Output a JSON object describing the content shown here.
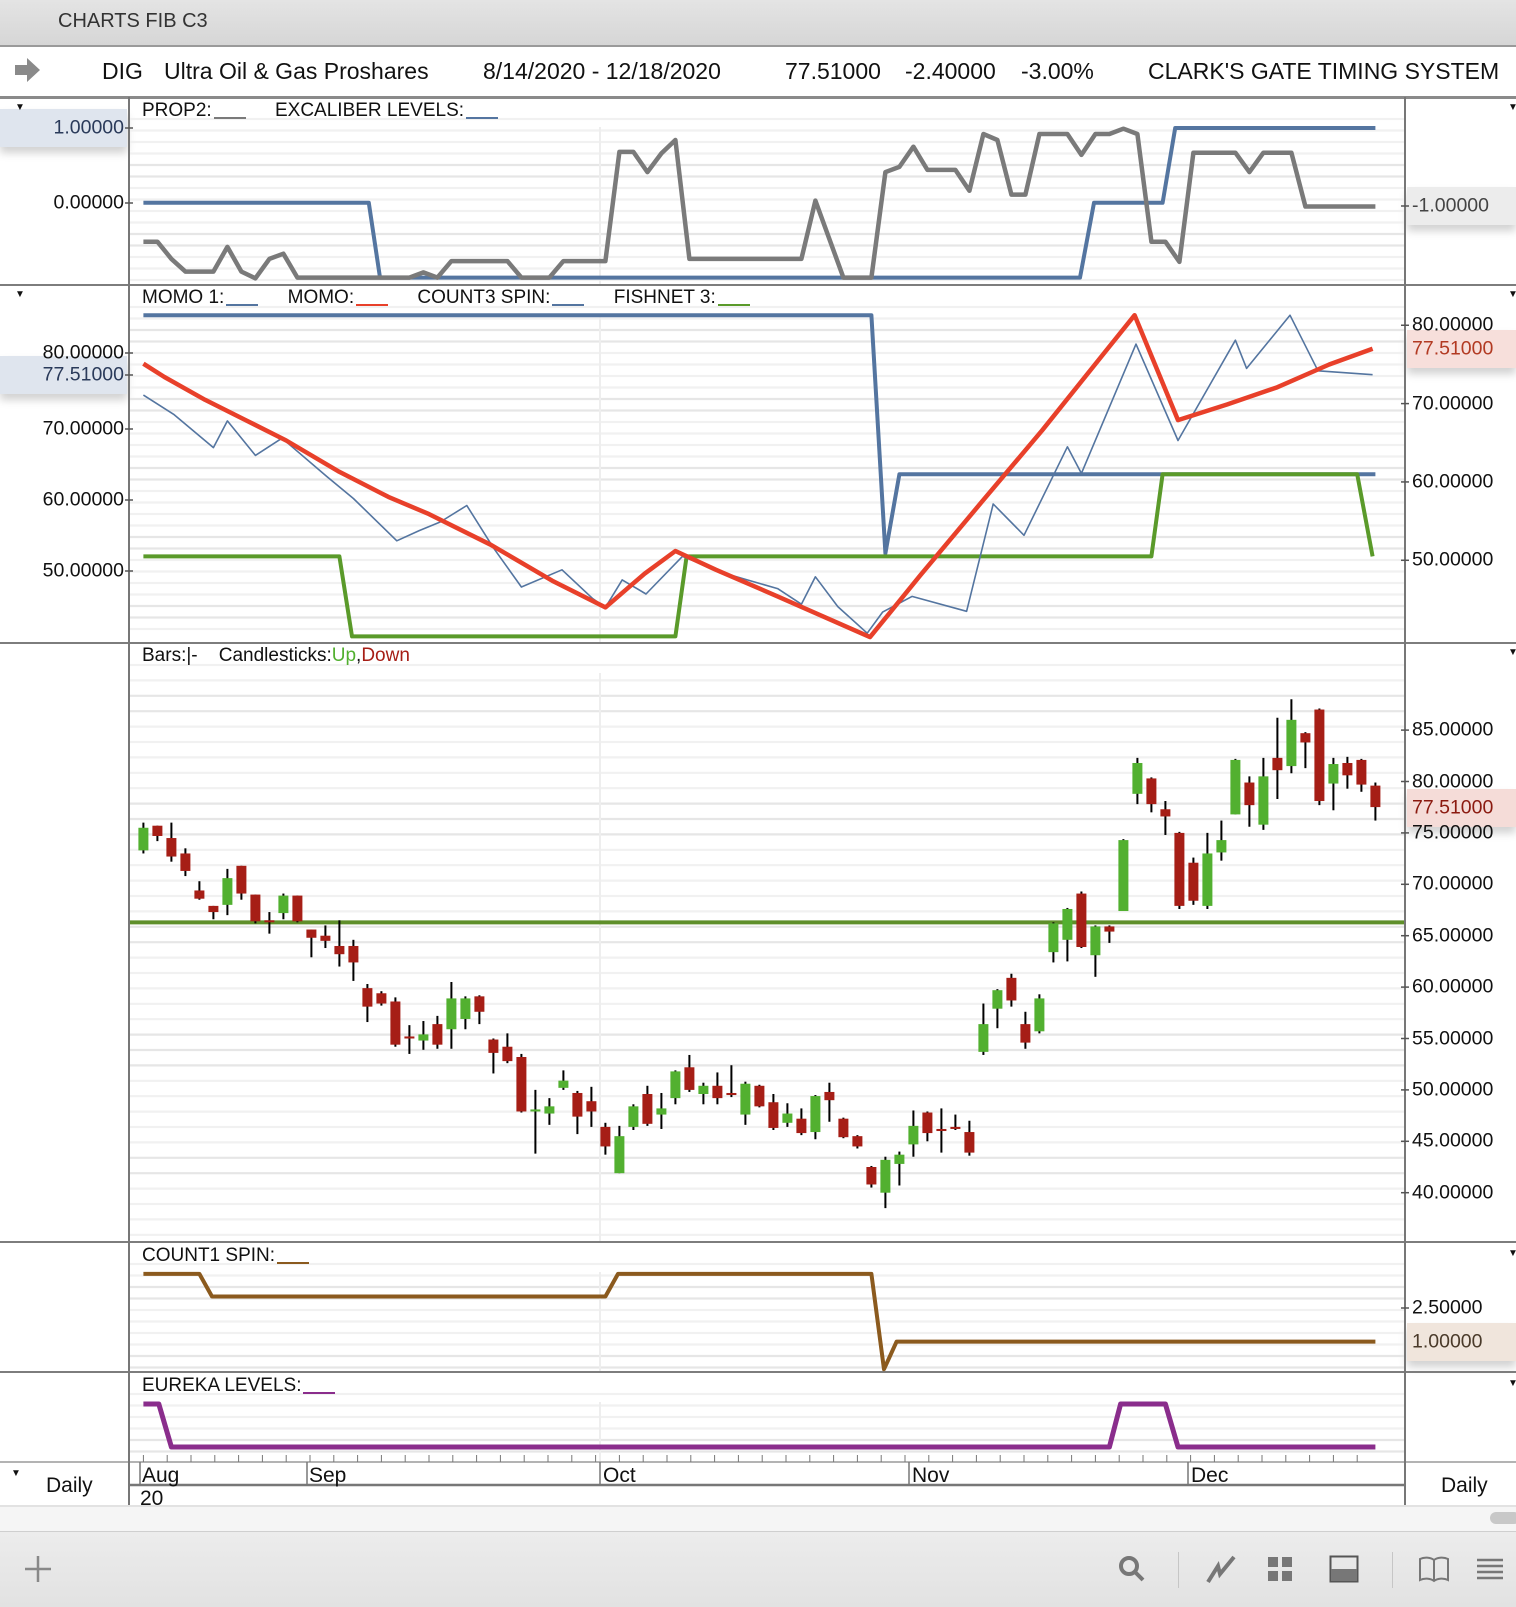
{
  "window": {
    "title": "CHARTS FIB C3"
  },
  "header": {
    "symbol": "DIG",
    "name": "Ultra Oil & Gas Proshares",
    "date_range": "8/14/2020 - 12/18/2020",
    "last": "77.51000",
    "change": "-2.40000",
    "change_pct": "-3.00%",
    "system": "CLARK'S GATE TIMING SYSTEM"
  },
  "panels": {
    "p1": {
      "legend": [
        {
          "label": "PROP2:",
          "color": "#7a7a7a"
        },
        {
          "label": "EXCALIBER LEVELS:",
          "color": "#5475a0"
        }
      ],
      "left_labels": [
        "1.00000",
        "0.00000"
      ],
      "right_label": "-1.00000"
    },
    "p2": {
      "legend": [
        {
          "label": "MOMO 1:",
          "color": "#5475a0"
        },
        {
          "label": "MOMO:",
          "color": "#e8402a"
        },
        {
          "label": "COUNT3 SPIN:",
          "color": "#5475a0"
        },
        {
          "label": "FISHNET 3:",
          "color": "#5a9a2a"
        }
      ],
      "left_labels": [
        "80.00000",
        "77.51000",
        "70.00000",
        "60.00000",
        "50.00000"
      ],
      "right_labels": [
        "80.00000",
        "70.00000",
        "60.00000",
        "50.00000"
      ],
      "right_current": "77.51000"
    },
    "p3": {
      "bars_label": "Bars:",
      "bars_symbol": "|-",
      "candles_label": "Candlesticks:",
      "up": "Up",
      "comma": ",",
      "down": "Down",
      "up_color": "#52b030",
      "down_color": "#a61e16",
      "right_labels": [
        "85.00000",
        "80.00000",
        "75.00000",
        "70.00000",
        "65.00000",
        "60.00000",
        "55.00000",
        "50.00000",
        "45.00000",
        "40.00000"
      ],
      "right_current": "77.51000"
    },
    "p4": {
      "legend": [
        {
          "label": "COUNT1 SPIN:",
          "color": "#8b5a1e"
        }
      ],
      "right_labels": [
        "2.50000"
      ],
      "right_current": "1.00000"
    },
    "p5": {
      "legend": [
        {
          "label": "EUREKA LEVELS:",
          "color": "#8a2d8c"
        }
      ]
    }
  },
  "date_axis": {
    "months": [
      "Aug",
      "Sep",
      "Oct",
      "Nov",
      "Dec"
    ],
    "year": "20",
    "period_left": "Daily",
    "period_right": "Daily"
  },
  "toolbar": {
    "icons": [
      "add-icon",
      "search-icon",
      "line-chart-icon",
      "grid-icon",
      "panel-layout-icon",
      "book-icon",
      "menu-icon"
    ]
  },
  "chart_data": {
    "type": "candlestick",
    "title": "DIG Ultra Oil & Gas Proshares",
    "x_range": [
      "8/14/2020",
      "12/18/2020"
    ],
    "candles_ohlc": [
      [
        73.3,
        76.0,
        73.0,
        75.5
      ],
      [
        75.7,
        75.7,
        74.2,
        74.7
      ],
      [
        74.5,
        76.0,
        72.2,
        72.7
      ],
      [
        73.0,
        73.5,
        70.8,
        71.3
      ],
      [
        69.4,
        70.3,
        68.5,
        68.6
      ],
      [
        67.9,
        67.9,
        66.6,
        67.3
      ],
      [
        68.0,
        71.5,
        67.0,
        70.6
      ],
      [
        71.8,
        71.8,
        68.5,
        69.1
      ],
      [
        69.0,
        69.0,
        66.2,
        66.4
      ],
      [
        66.5,
        67.3,
        65.2,
        66.4
      ],
      [
        67.2,
        69.1,
        66.6,
        68.9
      ],
      [
        68.9,
        68.9,
        66.3,
        66.4
      ],
      [
        65.6,
        65.6,
        62.9,
        64.8
      ],
      [
        65.0,
        66.0,
        63.8,
        64.5
      ],
      [
        64.0,
        66.5,
        62.0,
        63.2
      ],
      [
        64.0,
        64.6,
        60.6,
        62.4
      ],
      [
        59.9,
        60.3,
        56.6,
        58.1
      ],
      [
        59.4,
        59.6,
        58.2,
        58.4
      ],
      [
        58.6,
        59.0,
        54.2,
        54.4
      ],
      [
        55.2,
        56.3,
        53.5,
        55.0
      ],
      [
        54.8,
        56.7,
        53.9,
        55.4
      ],
      [
        56.4,
        57.2,
        54.0,
        54.4
      ],
      [
        55.9,
        60.5,
        54.0,
        58.9
      ],
      [
        56.9,
        59.1,
        55.9,
        58.9
      ],
      [
        59.1,
        59.2,
        56.4,
        57.6
      ],
      [
        54.9,
        55.0,
        51.6,
        53.6
      ],
      [
        54.2,
        55.5,
        52.6,
        52.8
      ],
      [
        53.2,
        53.5,
        47.8,
        47.9
      ],
      [
        47.9,
        50.0,
        43.8,
        48.1
      ],
      [
        47.7,
        49.2,
        46.6,
        48.4
      ],
      [
        50.2,
        51.9,
        50.0,
        50.9
      ],
      [
        49.7,
        49.9,
        45.7,
        47.4
      ],
      [
        48.9,
        50.3,
        46.4,
        47.9
      ],
      [
        46.4,
        46.8,
        43.7,
        44.5
      ],
      [
        41.9,
        46.5,
        41.9,
        45.5
      ],
      [
        46.4,
        48.6,
        46.1,
        48.4
      ],
      [
        49.6,
        50.4,
        46.5,
        46.7
      ],
      [
        47.6,
        49.7,
        46.2,
        48.2
      ],
      [
        49.2,
        51.9,
        48.6,
        51.8
      ],
      [
        52.2,
        53.4,
        49.8,
        50.0
      ],
      [
        49.6,
        50.7,
        48.6,
        50.4
      ],
      [
        50.4,
        51.7,
        48.6,
        49.2
      ],
      [
        49.7,
        52.4,
        49.3,
        49.5
      ],
      [
        47.6,
        50.8,
        46.6,
        50.6
      ],
      [
        50.4,
        50.5,
        48.3,
        48.4
      ],
      [
        48.8,
        49.6,
        46.1,
        46.3
      ],
      [
        46.8,
        48.7,
        46.4,
        47.7
      ],
      [
        47.2,
        48.2,
        45.6,
        45.8
      ],
      [
        45.9,
        49.5,
        45.2,
        49.4
      ],
      [
        49.8,
        50.7,
        46.9,
        49.0
      ],
      [
        47.2,
        47.3,
        45.3,
        45.4
      ],
      [
        45.5,
        45.6,
        44.3,
        44.5
      ],
      [
        42.5,
        42.6,
        40.5,
        40.8
      ],
      [
        40.0,
        43.5,
        38.5,
        43.2
      ],
      [
        42.8,
        44.0,
        40.7,
        43.7
      ],
      [
        44.7,
        48.0,
        43.5,
        46.5
      ],
      [
        47.8,
        47.9,
        45.0,
        45.8
      ],
      [
        46.2,
        48.2,
        43.9,
        46.0
      ],
      [
        46.4,
        47.6,
        46.1,
        46.2
      ],
      [
        45.9,
        47.0,
        43.6,
        43.9
      ],
      [
        53.7,
        58.4,
        53.4,
        56.4
      ],
      [
        57.9,
        59.8,
        56.0,
        59.7
      ],
      [
        60.9,
        61.3,
        58.1,
        58.7
      ],
      [
        56.4,
        57.6,
        54.0,
        54.6
      ],
      [
        55.7,
        59.3,
        55.5,
        58.9
      ],
      [
        63.4,
        66.3,
        62.4,
        66.2
      ],
      [
        64.6,
        67.7,
        62.5,
        67.6
      ],
      [
        69.1,
        69.3,
        63.8,
        63.9
      ],
      [
        63.1,
        66.0,
        61.0,
        65.9
      ],
      [
        65.9,
        66.0,
        64.3,
        65.4
      ],
      [
        67.4,
        74.4,
        67.4,
        74.3
      ],
      [
        78.8,
        82.3,
        77.8,
        81.8
      ],
      [
        80.3,
        80.4,
        77.0,
        77.8
      ],
      [
        77.3,
        78.1,
        74.8,
        76.6
      ],
      [
        75.0,
        75.1,
        67.6,
        67.9
      ],
      [
        72.1,
        72.6,
        68.0,
        68.4
      ],
      [
        67.9,
        75.0,
        67.6,
        73.0
      ],
      [
        73.1,
        76.2,
        72.3,
        74.3
      ],
      [
        76.8,
        82.2,
        76.8,
        82.1
      ],
      [
        79.9,
        80.5,
        75.6,
        77.7
      ],
      [
        75.8,
        82.3,
        75.3,
        80.5
      ],
      [
        82.3,
        86.2,
        78.3,
        81.1
      ],
      [
        81.5,
        88.0,
        80.8,
        86.0
      ],
      [
        84.7,
        84.8,
        81.3,
        83.8
      ],
      [
        87.0,
        87.1,
        77.7,
        78.1
      ],
      [
        79.8,
        82.3,
        77.2,
        81.7
      ],
      [
        81.8,
        82.4,
        79.3,
        80.6
      ],
      [
        82.1,
        82.2,
        79.0,
        79.7
      ],
      [
        79.6,
        79.9,
        76.2,
        77.51
      ]
    ],
    "price_range": [
      35.5,
      90.8
    ],
    "horizontal_level": 66.3,
    "indicator_series": {
      "prop2": [
        [
          0,
          -0.52
        ],
        [
          1,
          -0.52
        ],
        [
          2,
          -0.75
        ],
        [
          3,
          -0.92
        ],
        [
          5,
          -0.92
        ],
        [
          6,
          -0.59
        ],
        [
          7,
          -0.92
        ],
        [
          8,
          -1.01
        ],
        [
          9,
          -0.75
        ],
        [
          10,
          -0.68
        ],
        [
          11,
          -1.0
        ],
        [
          19,
          -1.0
        ],
        [
          20,
          -0.93
        ],
        [
          21,
          -1.0
        ],
        [
          22,
          -0.78
        ],
        [
          26,
          -0.78
        ],
        [
          27,
          -1.0
        ],
        [
          29,
          -1.0
        ],
        [
          30,
          -0.78
        ],
        [
          33,
          -0.78
        ],
        [
          34,
          0.68
        ],
        [
          35,
          0.68
        ],
        [
          36,
          0.41
        ],
        [
          37,
          0.66
        ],
        [
          38,
          0.84
        ],
        [
          39,
          -0.75
        ],
        [
          47,
          -0.75
        ],
        [
          48,
          0.03
        ],
        [
          50,
          -1.0
        ],
        [
          52,
          -1.0
        ],
        [
          53,
          0.41
        ],
        [
          54,
          0.48
        ],
        [
          55,
          0.75
        ],
        [
          56,
          0.44
        ],
        [
          58,
          0.44
        ],
        [
          59,
          0.16
        ],
        [
          60,
          0.92
        ],
        [
          61,
          0.84
        ],
        [
          62,
          0.11
        ],
        [
          63,
          0.11
        ],
        [
          64,
          0.92
        ],
        [
          66,
          0.92
        ],
        [
          67,
          0.64
        ],
        [
          68,
          0.92
        ],
        [
          69,
          0.92
        ],
        [
          70,
          0.99
        ],
        [
          71,
          0.92
        ],
        [
          72,
          -0.52
        ],
        [
          73,
          -0.52
        ],
        [
          74,
          -0.79
        ],
        [
          75,
          0.67
        ],
        [
          78,
          0.67
        ],
        [
          79,
          0.41
        ],
        [
          80,
          0.67
        ],
        [
          82,
          0.67
        ],
        [
          83,
          -0.05
        ],
        [
          88,
          -0.05
        ]
      ],
      "excaliber_levels": [
        [
          0,
          0
        ],
        [
          16.1,
          0
        ],
        [
          16.9,
          -1
        ],
        [
          66.9,
          -1
        ],
        [
          67.9,
          0
        ],
        [
          72.8,
          0
        ],
        [
          73.7,
          1
        ],
        [
          88,
          1
        ]
      ],
      "momo1": [
        [
          0,
          71.6
        ],
        [
          2.2,
          69.1
        ],
        [
          5,
          64.9
        ],
        [
          6,
          68.3
        ],
        [
          8,
          63.9
        ],
        [
          9.9,
          66.1
        ],
        [
          13.1,
          61.2
        ],
        [
          15,
          58.4
        ],
        [
          18.1,
          53.0
        ],
        [
          19.7,
          54.3
        ],
        [
          21.2,
          55.4
        ],
        [
          23.1,
          57.5
        ],
        [
          25,
          52.1
        ],
        [
          27,
          47.1
        ],
        [
          29.9,
          49.3
        ],
        [
          32.1,
          45.6
        ],
        [
          33,
          44.5
        ],
        [
          34.2,
          48.0
        ],
        [
          35.9,
          46.2
        ],
        [
          38.5,
          51.0
        ],
        [
          41.6,
          48.8
        ],
        [
          45.3,
          46.9
        ],
        [
          47,
          44.9
        ],
        [
          48,
          48.4
        ],
        [
          49.6,
          44.6
        ],
        [
          51.7,
          41.2
        ],
        [
          52.8,
          43.9
        ],
        [
          54.9,
          45.9
        ],
        [
          58.8,
          44.0
        ],
        [
          60.7,
          57.7
        ],
        [
          62.9,
          53.7
        ],
        [
          66,
          65.0
        ],
        [
          67,
          61.6
        ],
        [
          70.9,
          78.1
        ],
        [
          73.9,
          65.8
        ],
        [
          78,
          78.6
        ],
        [
          78.8,
          75.0
        ],
        [
          81.9,
          81.8
        ],
        [
          83.9,
          74.7
        ],
        [
          87.8,
          74.2
        ]
      ],
      "momo": [
        [
          0,
          75.6
        ],
        [
          1.5,
          73.9
        ],
        [
          4.4,
          71.0
        ],
        [
          7.3,
          68.4
        ],
        [
          10.2,
          65.8
        ],
        [
          13.9,
          61.9
        ],
        [
          17.5,
          58.6
        ],
        [
          20.4,
          56.4
        ],
        [
          24.8,
          52.5
        ],
        [
          29.2,
          47.9
        ],
        [
          33,
          44.5
        ],
        [
          35.8,
          48.8
        ],
        [
          38,
          51.7
        ],
        [
          40.9,
          49.3
        ],
        [
          45.3,
          45.9
        ],
        [
          51.9,
          40.7
        ],
        [
          55.5,
          48.6
        ],
        [
          59.9,
          58.0
        ],
        [
          64.2,
          67.1
        ],
        [
          68.6,
          76.9
        ],
        [
          70.8,
          81.8
        ],
        [
          73.9,
          68.4
        ],
        [
          77.4,
          70.4
        ],
        [
          81,
          72.6
        ],
        [
          84.7,
          75.5
        ],
        [
          87.8,
          77.51
        ]
      ],
      "count3_spin": [
        [
          0,
          81.8
        ],
        [
          52,
          81.8
        ],
        [
          53,
          51.4
        ],
        [
          54,
          61.5
        ],
        [
          88,
          61.5
        ]
      ],
      "fishnet3": [
        [
          0,
          51.0
        ],
        [
          14,
          51.0
        ],
        [
          14.9,
          40.8
        ],
        [
          38,
          40.8
        ],
        [
          38.8,
          51.0
        ],
        [
          72,
          51.0
        ],
        [
          72.8,
          61.5
        ],
        [
          86.7,
          61.5
        ],
        [
          87.8,
          51.0
        ]
      ],
      "count1_spin": [
        [
          0,
          3.95
        ],
        [
          4,
          3.95
        ],
        [
          4.9,
          2.98
        ],
        [
          33,
          2.98
        ],
        [
          33.9,
          3.95
        ],
        [
          52,
          3.95
        ],
        [
          52.9,
          -0.15
        ],
        [
          53.8,
          1.04
        ],
        [
          88,
          1.04
        ]
      ],
      "eureka_levels": [
        [
          0,
          1
        ],
        [
          1.1,
          1
        ],
        [
          2,
          0
        ],
        [
          69,
          0
        ],
        [
          69.8,
          1
        ],
        [
          73,
          1
        ],
        [
          73.9,
          0
        ],
        [
          88,
          0
        ]
      ]
    }
  }
}
